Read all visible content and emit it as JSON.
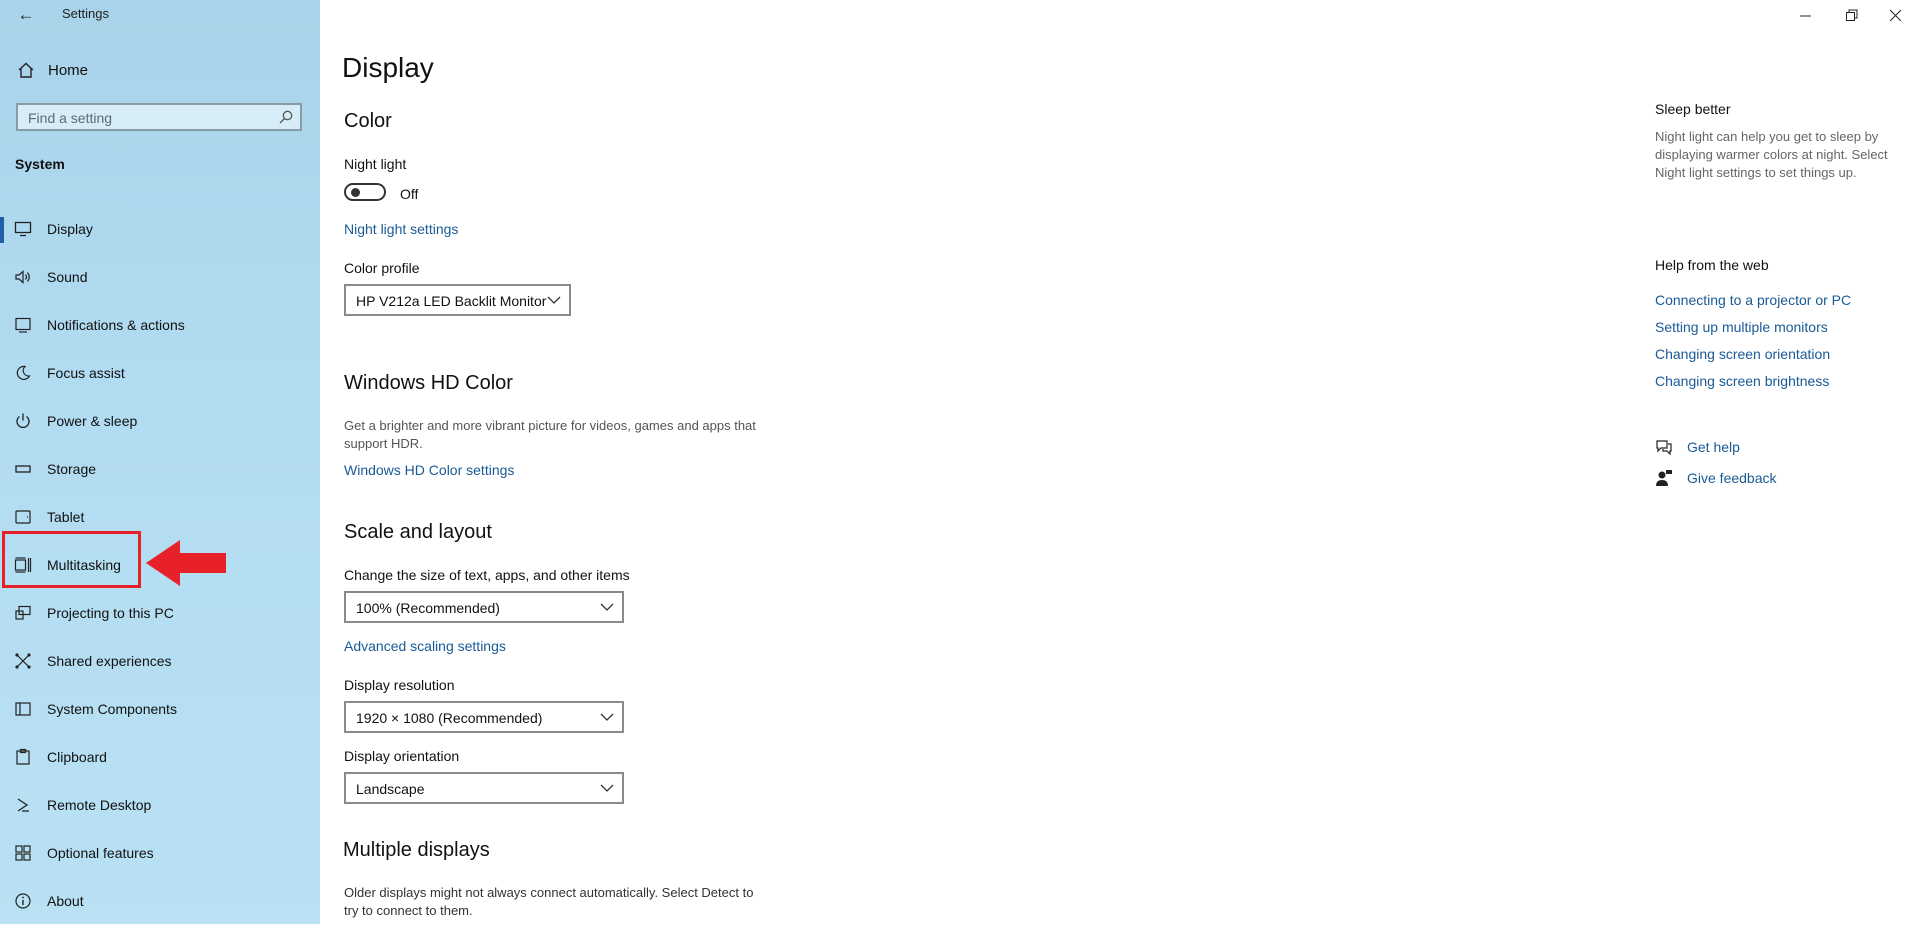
{
  "window": {
    "title": "Settings"
  },
  "sidebar": {
    "home_label": "Home",
    "search_placeholder": "Find a setting",
    "section": "System",
    "items": [
      {
        "label": "Display",
        "icon": "monitor-icon",
        "active": true
      },
      {
        "label": "Sound",
        "icon": "speaker-icon"
      },
      {
        "label": "Notifications & actions",
        "icon": "notification-icon"
      },
      {
        "label": "Focus assist",
        "icon": "moon-icon"
      },
      {
        "label": "Power & sleep",
        "icon": "power-icon"
      },
      {
        "label": "Storage",
        "icon": "storage-icon"
      },
      {
        "label": "Tablet",
        "icon": "tablet-icon"
      },
      {
        "label": "Multitasking",
        "icon": "multitasking-icon"
      },
      {
        "label": "Projecting to this PC",
        "icon": "projecting-icon"
      },
      {
        "label": "Shared experiences",
        "icon": "shared-experiences-icon"
      },
      {
        "label": "System Components",
        "icon": "system-components-icon"
      },
      {
        "label": "Clipboard",
        "icon": "clipboard-icon"
      },
      {
        "label": "Remote Desktop",
        "icon": "remote-desktop-icon"
      },
      {
        "label": "Optional features",
        "icon": "optional-features-icon"
      },
      {
        "label": "About",
        "icon": "info-icon"
      }
    ]
  },
  "main": {
    "title": "Display",
    "color": {
      "heading": "Color",
      "night_light_label": "Night light",
      "night_light_state": "Off",
      "night_light_link": "Night light settings",
      "color_profile_label": "Color profile",
      "color_profile_value": "HP V212a LED Backlit Monitor"
    },
    "hdr": {
      "heading": "Windows HD Color",
      "desc_line1": "Get a brighter and more vibrant picture for videos, games and apps that",
      "desc_line2": "support HDR.",
      "link": "Windows HD Color settings"
    },
    "scale": {
      "heading": "Scale and layout",
      "size_label": "Change the size of text, apps, and other items",
      "size_value": "100% (Recommended)",
      "advanced_link": "Advanced scaling settings",
      "resolution_label": "Display resolution",
      "resolution_value": "1920 × 1080 (Recommended)",
      "orientation_label": "Display orientation",
      "orientation_value": "Landscape"
    },
    "multiple": {
      "heading": "Multiple displays",
      "desc_line1": "Older displays might not always connect automatically. Select Detect to",
      "desc_line2": "try to connect to them."
    }
  },
  "aside": {
    "sleep_heading": "Sleep better",
    "sleep_desc": "Night light can help you get to sleep by displaying warmer colors at night. Select Night light settings to set things up.",
    "help_heading": "Help from the web",
    "links": [
      "Connecting to a projector or PC",
      "Setting up multiple monitors",
      "Changing screen orientation",
      "Changing screen brightness"
    ],
    "get_help": "Get help",
    "give_feedback": "Give feedback"
  },
  "colors": {
    "sidebar_bg": "#b2dcf1",
    "accent": "#1f5fa8",
    "link": "#1a5a96",
    "annotation_red": "#e8202a"
  }
}
